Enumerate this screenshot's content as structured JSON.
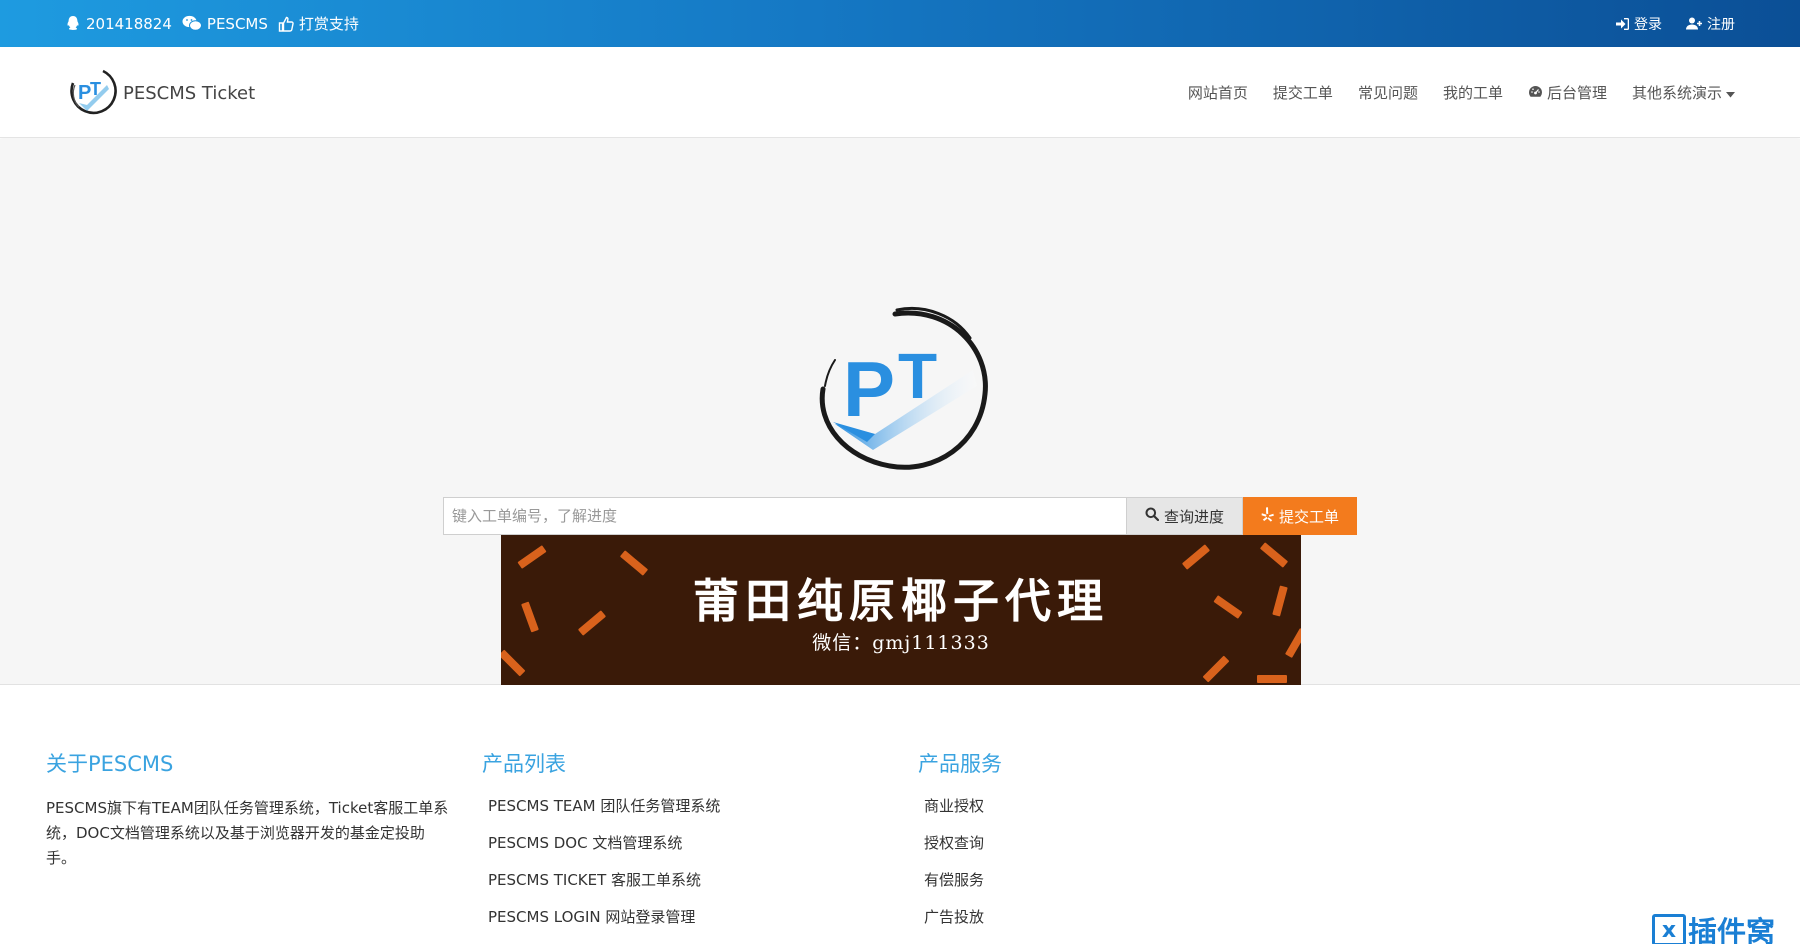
{
  "topbar": {
    "qq": "201418824",
    "wechat": "PESCMS",
    "donate": "打赏支持",
    "login": "登录",
    "register": "注册"
  },
  "brand": {
    "name": "PESCMS Ticket",
    "logo_text": "PT"
  },
  "nav": {
    "items": [
      {
        "label": "网站首页"
      },
      {
        "label": "提交工单"
      },
      {
        "label": "常见问题"
      },
      {
        "label": "我的工单"
      },
      {
        "label": "后台管理",
        "icon": "dashboard-icon"
      },
      {
        "label": "其他系统演示",
        "icon": "caret-down-icon"
      }
    ]
  },
  "hero": {
    "logo_text": "PT",
    "search": {
      "placeholder": "键入工单编号，了解进度",
      "query_label": "查询进度",
      "submit_label": "提交工单"
    },
    "ad": {
      "title": "莆田纯原椰子代理",
      "subtitle": "微信：gmj111333"
    }
  },
  "footer": {
    "about": {
      "title": "关于PESCMS",
      "text": "PESCMS旗下有TEAM团队任务管理系统，Ticket客服工单系统，DOC文档管理系统以及基于浏览器开发的基金定投助手。"
    },
    "products": {
      "title": "产品列表",
      "items": [
        "PESCMS TEAM 团队任务管理系统",
        "PESCMS DOC 文档管理系统",
        "PESCMS TICKET 客服工单系统",
        "PESCMS LOGIN 网站登录管理"
      ]
    },
    "services": {
      "title": "产品服务",
      "items": [
        "商业授权",
        "授权查询",
        "有偿服务",
        "广告投放"
      ]
    }
  },
  "watermark": {
    "box": "x",
    "text": "插件窝"
  },
  "colors": {
    "topbar_start": "#1e9be0",
    "topbar_end": "#0b4f96",
    "accent": "#3aa3e0",
    "submit_button": "#f37b1d",
    "ad_background": "#3a1a08"
  }
}
